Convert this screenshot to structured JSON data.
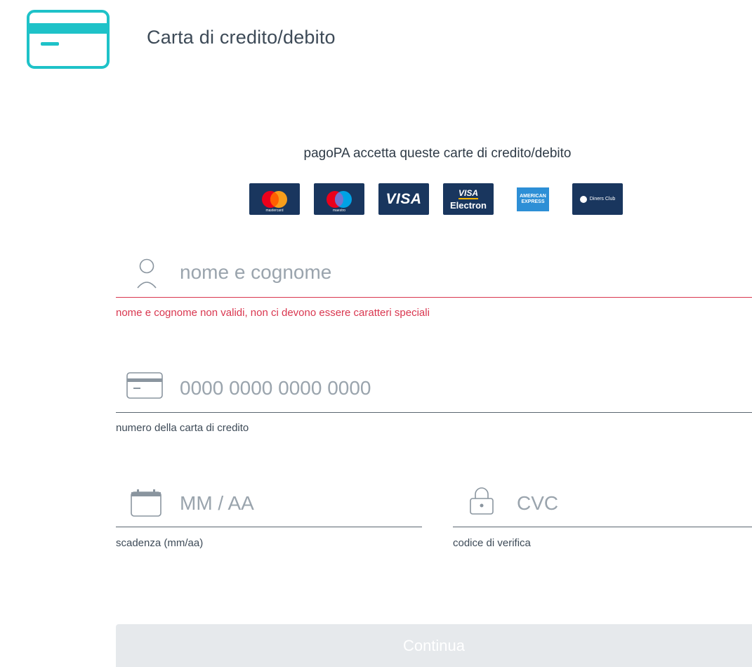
{
  "header": {
    "title": "Carta di credito/debito",
    "icon": "credit-card-icon",
    "accent": "#1ec2c8"
  },
  "accepted": {
    "text": "pagoPA accetta queste carte di credito/debito",
    "cards": [
      "mastercard",
      "maestro",
      "VISA",
      "VISA Electron",
      "AMERICAN EXPRESS",
      "Diners Club"
    ]
  },
  "form": {
    "name": {
      "placeholder": "nome e cognome",
      "icon": "user-icon",
      "error": "nome e cognome non validi, non ci devono essere caratteri speciali"
    },
    "card_number": {
      "placeholder": "0000 0000 0000 0000",
      "icon": "credit-card-icon",
      "help": "numero della carta di credito"
    },
    "expiry": {
      "placeholder": "MM / AA",
      "icon": "calendar-icon",
      "help": "scadenza (mm/aa)"
    },
    "cvc": {
      "placeholder": "CVC",
      "icon": "lock-icon",
      "help": "codice di verifica"
    },
    "continue_label": "Continua"
  },
  "colors": {
    "error": "#d9364f",
    "card_bg": "#19365e",
    "button_disabled": "#e6e9ec"
  }
}
